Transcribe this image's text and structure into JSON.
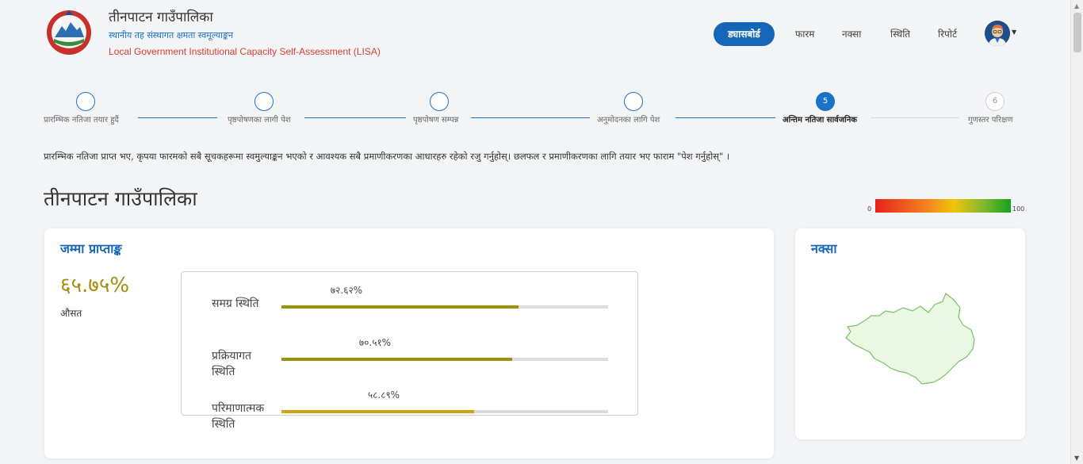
{
  "header": {
    "org_name": "तीनपाटन गाउँपालिका",
    "org_subtitle": "स्थानीय तह संस्थागत क्षमता स्वमूल्याङ्कन",
    "org_subtitle_en": "Local Government Institutional Capacity Self-Assessment (LISA)"
  },
  "nav": {
    "dashboard": "ड्यासबोर्ड",
    "form": "फारम",
    "map": "नक्सा",
    "status": "स्थिति",
    "report": "रिपोर्ट"
  },
  "stepper": {
    "steps": [
      {
        "label": "प्रारम्भिक नतिजा तयार हुदैं",
        "number": "",
        "state": "done"
      },
      {
        "label": "पृष्ठपोषणका लागी पेश",
        "number": "",
        "state": "done"
      },
      {
        "label": "पृष्ठपोषण सम्पन्न",
        "number": "",
        "state": "done"
      },
      {
        "label": "अनुमोदनका लागि पेश",
        "number": "",
        "state": "done"
      },
      {
        "label": "अन्तिम नतिजा सार्वजनिक",
        "number": "5",
        "state": "active"
      },
      {
        "label": "गुणस्तर परिक्षण",
        "number": "6",
        "state": "pending"
      }
    ]
  },
  "instruction": "प्रारम्भिक नतिजा प्राप्त भए, कृपया फारमको सबै सूचकहरूमा स्वमुल्याङ्कन भएको र आवश्यक सबै प्रमाणीकरणका आधारहरु रहेको रजु गर्नुहोस्। छलफल र प्रमाणीकरणका लागि तयार भए फाराम \"पेश गर्नुहोस्\" ।",
  "page_title": "तीनपाटन गाउँपालिका",
  "legend": {
    "min": "0",
    "max": "100"
  },
  "score_card": {
    "title": "जम्मा प्राप्ताङ्क",
    "total": "६५.७५%",
    "total_label": "औसत",
    "bars": [
      {
        "label": "समग्र स्थिति",
        "percent_text": "७२.६२%",
        "value": 72.62,
        "color": "#9a9309"
      },
      {
        "label": "प्रक्रियागत स्थिति",
        "percent_text": "७०.५१%",
        "value": 70.51,
        "color": "#9a9309"
      },
      {
        "label": "परिमाणात्मक स्थिति",
        "percent_text": "५८.८९%",
        "value": 58.89,
        "color": "#d3a10e"
      }
    ]
  },
  "map_card": {
    "title": "नक्सा",
    "fill_color": "#eaf7e2",
    "stroke_color": "#7cbf6a"
  },
  "colors": {
    "primary": "#1666b8",
    "title_blue": "#1767b5",
    "score_gold": "#a58d0e",
    "english_red": "#d83a3a"
  }
}
